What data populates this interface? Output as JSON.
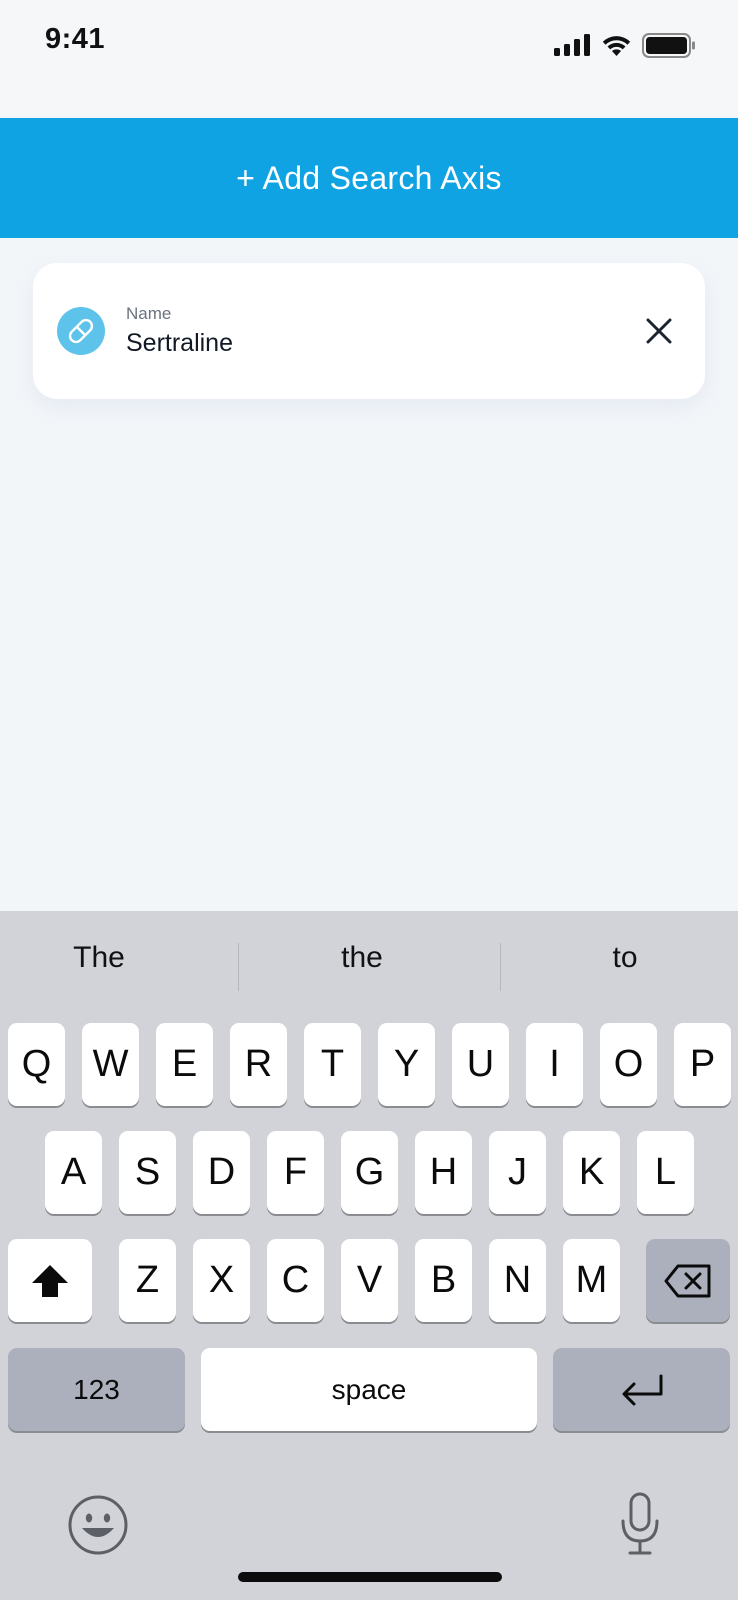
{
  "status_bar": {
    "time": "9:41",
    "icons": [
      "cellular-signal-icon",
      "wifi-icon",
      "battery-icon"
    ]
  },
  "header": {
    "add_axis_label": "+ Add Search Axis"
  },
  "search_axis": {
    "icon": "pill-icon",
    "label": "Name",
    "value": "Sertraline",
    "remove_icon": "close-icon"
  },
  "keyboard": {
    "suggestions": [
      "The",
      "the",
      "to"
    ],
    "row1": [
      "Q",
      "W",
      "E",
      "R",
      "T",
      "Y",
      "U",
      "I",
      "O",
      "P"
    ],
    "row2": [
      "A",
      "S",
      "D",
      "F",
      "G",
      "H",
      "J",
      "K",
      "L"
    ],
    "row3": [
      "Z",
      "X",
      "C",
      "V",
      "B",
      "N",
      "M"
    ],
    "shift_icon": "shift-icon",
    "delete_icon": "backspace-icon",
    "numbers_label": "123",
    "space_label": "space",
    "return_icon": "return-icon",
    "emoji_icon": "emoji-icon",
    "mic_icon": "microphone-icon"
  },
  "colors": {
    "accent": "#10a3e3",
    "pill_icon": "#5ec3ea",
    "background": "#f3f6f9",
    "keyboard": "#d1d3d9",
    "dark_key": "#abb0bc"
  }
}
